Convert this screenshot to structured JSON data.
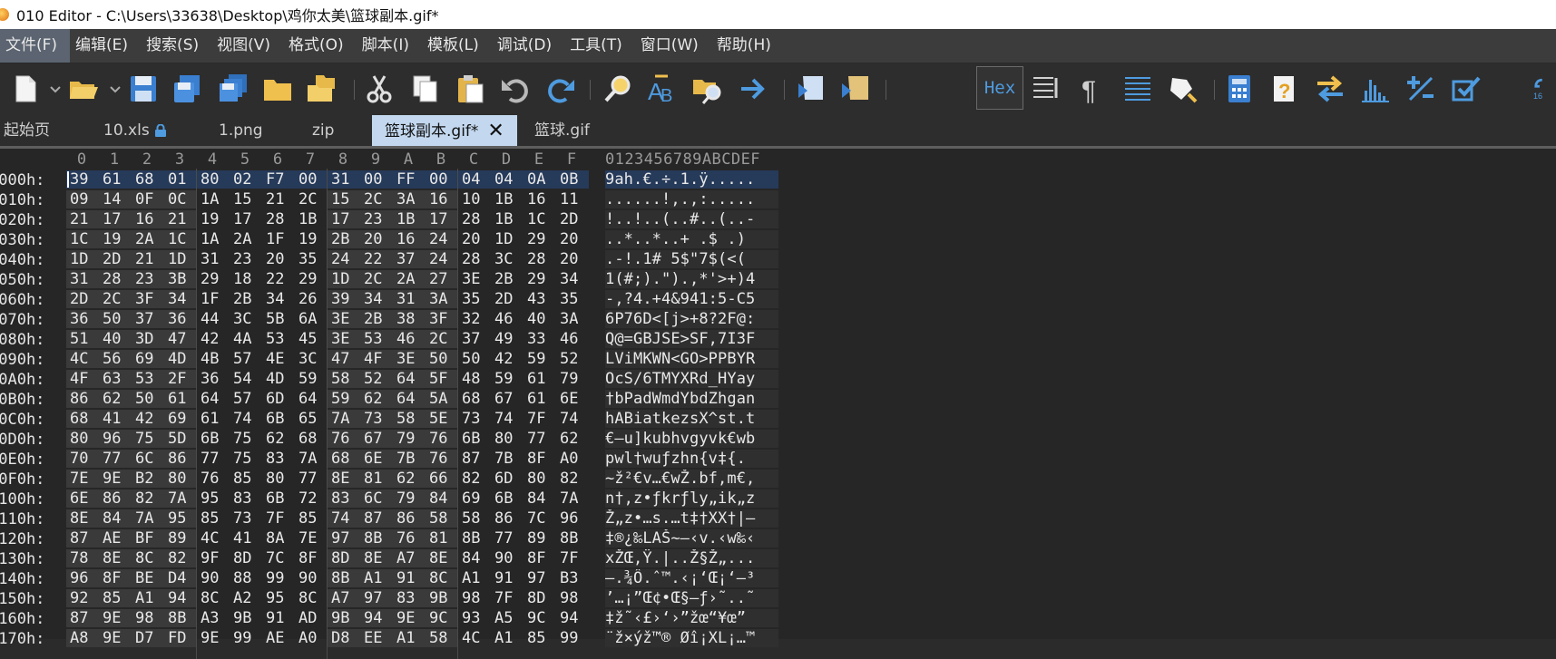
{
  "window": {
    "title": "010 Editor - C:\\Users\\33638\\Desktop\\鸡你太美\\篮球副本.gif*"
  },
  "menu": [
    "文件(F)",
    "编辑(E)",
    "搜索(S)",
    "视图(V)",
    "格式(O)",
    "脚本(I)",
    "模板(L)",
    "调试(D)",
    "工具(T)",
    "窗口(W)",
    "帮助(H)"
  ],
  "toolbar": {
    "hex_label": "Hex",
    "icons": [
      "new-file-icon",
      "open-folder-icon",
      "save-icon",
      "save-as-icon",
      "save-all-icon",
      "folder-icon",
      "open-multiple-icon",
      "cut-icon",
      "copy-icon",
      "paste-icon",
      "undo-icon",
      "redo-icon",
      "find-icon",
      "replace-icon",
      "find-in-files-icon",
      "goto-icon",
      "run-script-icon",
      "run-template-icon",
      "hex-mode-icon",
      "columns-icon",
      "pilcrow-icon",
      "lines-icon",
      "highlight-icon",
      "calculator-icon",
      "inspector-icon",
      "compare-icon",
      "histogram-icon",
      "checksum-icon",
      "check-icon",
      "base-converter-icon"
    ]
  },
  "tabs": [
    {
      "label": "起始页",
      "active": false,
      "locked": false
    },
    {
      "label": "10.xls",
      "active": false,
      "locked": true
    },
    {
      "label": "1.png",
      "active": false,
      "locked": false
    },
    {
      "label": "zip",
      "active": false,
      "locked": false
    },
    {
      "label": "篮球副本.gif*",
      "active": true,
      "locked": false
    },
    {
      "label": "篮球.gif",
      "active": false,
      "locked": false
    }
  ],
  "hex": {
    "column_header": [
      "0",
      "1",
      "2",
      "3",
      "4",
      "5",
      "6",
      "7",
      "8",
      "9",
      "A",
      "B",
      "C",
      "D",
      "E",
      "F"
    ],
    "ascii_header": "0123456789ABCDEF",
    "rows": [
      {
        "addr": "0000h:",
        "bytes": [
          "39",
          "61",
          "68",
          "01",
          "80",
          "02",
          "F7",
          "00",
          "31",
          "00",
          "FF",
          "00",
          "04",
          "04",
          "0A",
          "0B"
        ],
        "ascii": "9ah.€.÷.1.ÿ.....",
        "selected": true
      },
      {
        "addr": "0010h:",
        "bytes": [
          "09",
          "14",
          "0F",
          "0C",
          "1A",
          "15",
          "21",
          "2C",
          "15",
          "2C",
          "3A",
          "16",
          "10",
          "1B",
          "16",
          "11"
        ],
        "ascii": "......!,.,:....."
      },
      {
        "addr": "0020h:",
        "bytes": [
          "21",
          "17",
          "16",
          "21",
          "19",
          "17",
          "28",
          "1B",
          "17",
          "23",
          "1B",
          "17",
          "28",
          "1B",
          "1C",
          "2D"
        ],
        "ascii": "!..!..(..#..(..-"
      },
      {
        "addr": "0030h:",
        "bytes": [
          "1C",
          "19",
          "2A",
          "1C",
          "1A",
          "2A",
          "1F",
          "19",
          "2B",
          "20",
          "16",
          "24",
          "20",
          "1D",
          "29",
          "20"
        ],
        "ascii": "..*..*..+ .$ .) "
      },
      {
        "addr": "0040h:",
        "bytes": [
          "1D",
          "2D",
          "21",
          "1D",
          "31",
          "23",
          "20",
          "35",
          "24",
          "22",
          "37",
          "24",
          "28",
          "3C",
          "28",
          "20"
        ],
        "ascii": ".-!.1# 5$\"7$(<( "
      },
      {
        "addr": "0050h:",
        "bytes": [
          "31",
          "28",
          "23",
          "3B",
          "29",
          "18",
          "22",
          "29",
          "1D",
          "2C",
          "2A",
          "27",
          "3E",
          "2B",
          "29",
          "34"
        ],
        "ascii": "1(#;).\").,*'>+)4"
      },
      {
        "addr": "0060h:",
        "bytes": [
          "2D",
          "2C",
          "3F",
          "34",
          "1F",
          "2B",
          "34",
          "26",
          "39",
          "34",
          "31",
          "3A",
          "35",
          "2D",
          "43",
          "35"
        ],
        "ascii": "-,?4.+4&941:5-C5"
      },
      {
        "addr": "0070h:",
        "bytes": [
          "36",
          "50",
          "37",
          "36",
          "44",
          "3C",
          "5B",
          "6A",
          "3E",
          "2B",
          "38",
          "3F",
          "32",
          "46",
          "40",
          "3A"
        ],
        "ascii": "6P76D<[j>+8?2F@:"
      },
      {
        "addr": "0080h:",
        "bytes": [
          "51",
          "40",
          "3D",
          "47",
          "42",
          "4A",
          "53",
          "45",
          "3E",
          "53",
          "46",
          "2C",
          "37",
          "49",
          "33",
          "46"
        ],
        "ascii": "Q@=GBJSE>SF,7I3F"
      },
      {
        "addr": "0090h:",
        "bytes": [
          "4C",
          "56",
          "69",
          "4D",
          "4B",
          "57",
          "4E",
          "3C",
          "47",
          "4F",
          "3E",
          "50",
          "50",
          "42",
          "59",
          "52"
        ],
        "ascii": "LViMKWN<GO>PPBYR"
      },
      {
        "addr": "00A0h:",
        "bytes": [
          "4F",
          "63",
          "53",
          "2F",
          "36",
          "54",
          "4D",
          "59",
          "58",
          "52",
          "64",
          "5F",
          "48",
          "59",
          "61",
          "79"
        ],
        "ascii": "OcS/6TMYXRd_HYay"
      },
      {
        "addr": "00B0h:",
        "bytes": [
          "86",
          "62",
          "50",
          "61",
          "64",
          "57",
          "6D",
          "64",
          "59",
          "62",
          "64",
          "5A",
          "68",
          "67",
          "61",
          "6E"
        ],
        "ascii": "†bPadWmdYbdZhgan"
      },
      {
        "addr": "00C0h:",
        "bytes": [
          "68",
          "41",
          "42",
          "69",
          "61",
          "74",
          "6B",
          "65",
          "7A",
          "73",
          "58",
          "5E",
          "73",
          "74",
          "7F",
          "74"
        ],
        "ascii": "hABiatkezsX^st.t"
      },
      {
        "addr": "00D0h:",
        "bytes": [
          "80",
          "96",
          "75",
          "5D",
          "6B",
          "75",
          "62",
          "68",
          "76",
          "67",
          "79",
          "76",
          "6B",
          "80",
          "77",
          "62"
        ],
        "ascii": "€–u]kubhvgyvk€wb"
      },
      {
        "addr": "00E0h:",
        "bytes": [
          "70",
          "77",
          "6C",
          "86",
          "77",
          "75",
          "83",
          "7A",
          "68",
          "6E",
          "7B",
          "76",
          "87",
          "7B",
          "8F",
          "A0"
        ],
        "ascii": "pwl†wuƒzhn{v‡{. "
      },
      {
        "addr": "00F0h:",
        "bytes": [
          "7E",
          "9E",
          "B2",
          "80",
          "76",
          "85",
          "80",
          "77",
          "8E",
          "81",
          "62",
          "66",
          "82",
          "6D",
          "80",
          "82"
        ],
        "ascii": "~ž²€v…€wŽ.bf‚m€‚"
      },
      {
        "addr": "0100h:",
        "bytes": [
          "6E",
          "86",
          "82",
          "7A",
          "95",
          "83",
          "6B",
          "72",
          "83",
          "6C",
          "79",
          "84",
          "69",
          "6B",
          "84",
          "7A"
        ],
        "ascii": "n†‚z•ƒkrƒly„ik„z"
      },
      {
        "addr": "0110h:",
        "bytes": [
          "8E",
          "84",
          "7A",
          "95",
          "85",
          "73",
          "7F",
          "85",
          "74",
          "87",
          "86",
          "58",
          "58",
          "86",
          "7C",
          "96"
        ],
        "ascii": "Ž„z•…s.…t‡†XX†|–"
      },
      {
        "addr": "0120h:",
        "bytes": [
          "87",
          "AE",
          "BF",
          "89",
          "4C",
          "41",
          "8A",
          "7E",
          "97",
          "8B",
          "76",
          "81",
          "8B",
          "77",
          "89",
          "8B"
        ],
        "ascii": "‡®¿‰LAŠ~—‹v.‹w‰‹"
      },
      {
        "addr": "0130h:",
        "bytes": [
          "78",
          "8E",
          "8C",
          "82",
          "9F",
          "8D",
          "7C",
          "8F",
          "8D",
          "8E",
          "A7",
          "8E",
          "84",
          "90",
          "8F",
          "7F"
        ],
        "ascii": "xŽŒ‚Ÿ.|..Ž§Ž„..."
      },
      {
        "addr": "0140h:",
        "bytes": [
          "96",
          "8F",
          "BE",
          "D4",
          "90",
          "88",
          "99",
          "90",
          "8B",
          "A1",
          "91",
          "8C",
          "A1",
          "91",
          "97",
          "B3"
        ],
        "ascii": "–.¾Ô.ˆ™.‹¡‘Œ¡‘—³"
      },
      {
        "addr": "0150h:",
        "bytes": [
          "92",
          "85",
          "A1",
          "94",
          "8C",
          "A2",
          "95",
          "8C",
          "A7",
          "97",
          "83",
          "9B",
          "98",
          "7F",
          "8D",
          "98"
        ],
        "ascii": "’…¡”Œ¢•Œ§—ƒ›˜..˜"
      },
      {
        "addr": "0160h:",
        "bytes": [
          "87",
          "9E",
          "98",
          "8B",
          "A3",
          "9B",
          "91",
          "AD",
          "9B",
          "94",
          "9E",
          "9C",
          "93",
          "A5",
          "9C",
          "94"
        ],
        "ascii": "‡ž˜‹£›‘­›”žœ“¥œ”"
      },
      {
        "addr": "0170h:",
        "bytes": [
          "A8",
          "9E",
          "D7",
          "FD",
          "9E",
          "99",
          "AE",
          "A0",
          "D8",
          "EE",
          "A1",
          "58",
          "4C",
          "A1",
          "85",
          "99"
        ],
        "ascii": "¨ž×ýž™® Øî¡XL¡…™"
      }
    ]
  }
}
